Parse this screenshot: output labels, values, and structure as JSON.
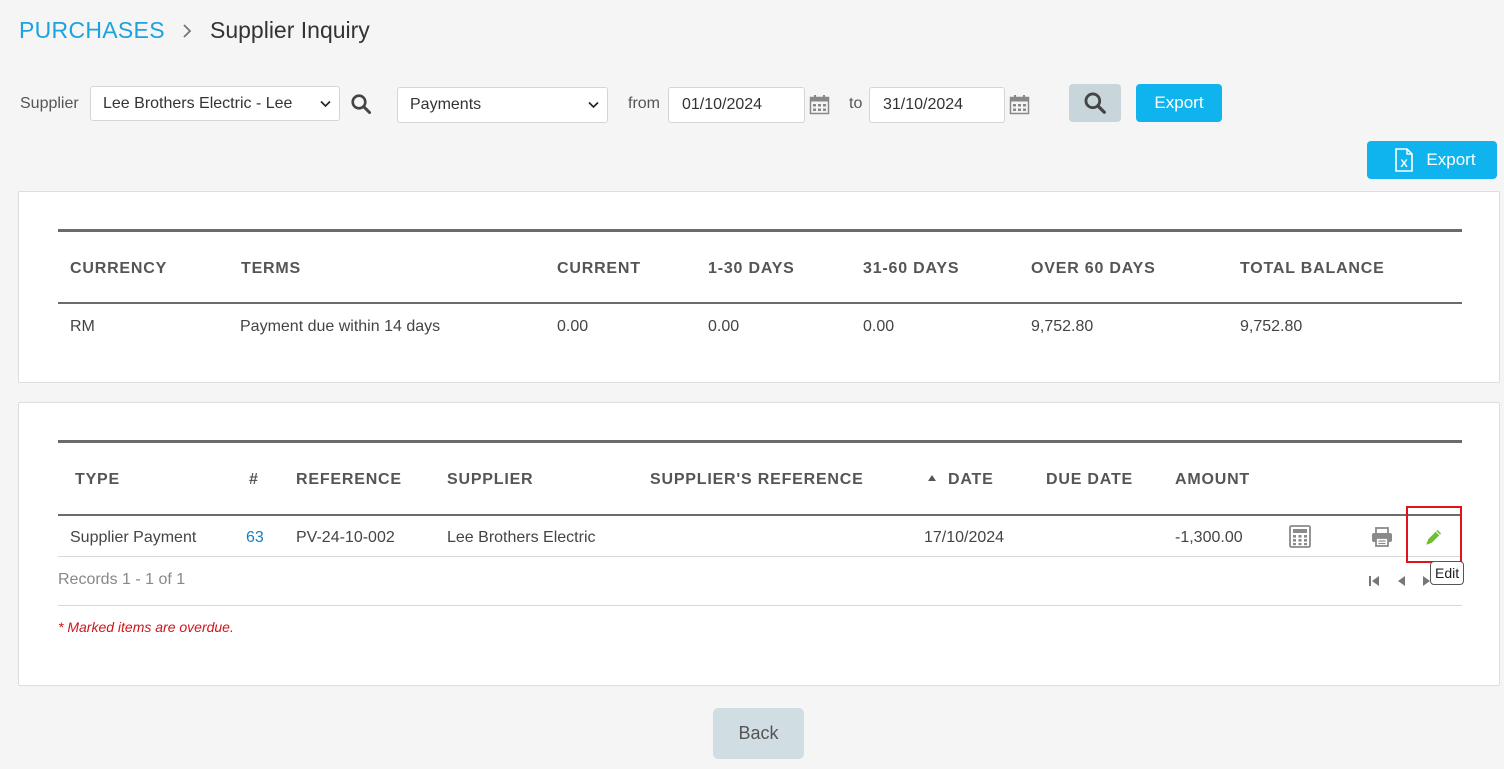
{
  "breadcrumb": {
    "root": "PURCHASES",
    "page": "Supplier Inquiry"
  },
  "filters": {
    "supplier_label": "Supplier",
    "supplier_value": "Lee Brothers Electric - Lee",
    "type_value": "Payments",
    "from_label": "from",
    "from_date": "01/10/2024",
    "to_label": "to",
    "to_date": "31/10/2024",
    "export_label": "Export"
  },
  "top_export_label": "Export",
  "summary": {
    "headers": [
      "CURRENCY",
      "TERMS",
      "CURRENT",
      "1-30 DAYS",
      "31-60 DAYS",
      "OVER 60 DAYS",
      "TOTAL BALANCE"
    ],
    "row": [
      "RM",
      "Payment due within 14 days",
      "0.00",
      "0.00",
      "0.00",
      "9,752.80",
      "9,752.80"
    ]
  },
  "transactions": {
    "headers": [
      "TYPE",
      "#",
      "REFERENCE",
      "SUPPLIER",
      "SUPPLIER'S REFERENCE",
      "DATE",
      "DUE DATE",
      "AMOUNT"
    ],
    "rows": [
      {
        "type": "Supplier Payment",
        "number": "63",
        "reference": "PV-24-10-002",
        "supplier": "Lee Brothers Electric",
        "supplier_reference": "",
        "date": "17/10/2024",
        "due_date": "",
        "amount": "-1,300.00"
      }
    ],
    "records_text": "Records 1 - 1 of 1",
    "sort_column": "DATE",
    "sort_direction": "ascending"
  },
  "tooltip": "Edit",
  "overdue_note": "* Marked items are overdue.",
  "back_label": "Back",
  "colors": {
    "accent": "#1aa3df",
    "button": "#0fb4ef",
    "edit_icon": "#6cc02c",
    "overdue": "#d1141c",
    "highlight": "#e0121c"
  }
}
